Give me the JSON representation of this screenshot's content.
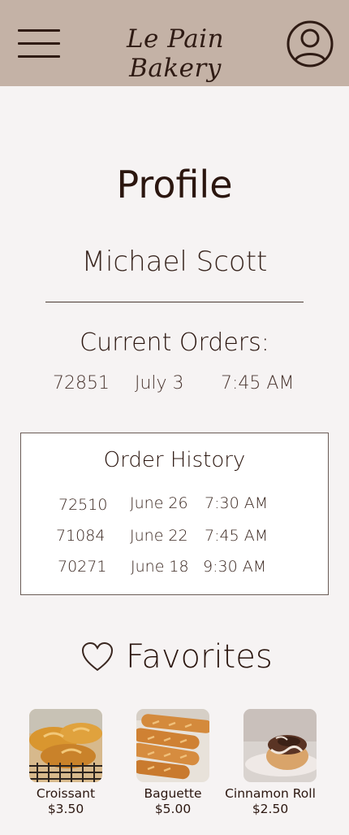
{
  "header": {
    "brand": "Le Pain Bakery",
    "menu_icon": "hamburger-menu-icon",
    "profile_icon": "user-circle-icon",
    "background_color": "#c4b2a6"
  },
  "profile": {
    "title": "Profile",
    "name": "Michael Scott"
  },
  "current_orders": {
    "title": "Current Orders:",
    "order": {
      "id": "72851",
      "date": "July 3",
      "time": "7:45 AM"
    }
  },
  "order_history": {
    "title": "Order History",
    "orders": [
      {
        "id": "72510",
        "date": "June 26",
        "time": "7:30 AM"
      },
      {
        "id": "71084",
        "date": "June 22",
        "time": "7:45 AM"
      },
      {
        "id": "70271",
        "date": "June 18",
        "time": "9:30 AM"
      }
    ]
  },
  "favorites": {
    "title": "Favorites",
    "icon": "heart-icon",
    "items": [
      {
        "name": "Croissant",
        "price": "$3.50"
      },
      {
        "name": "Baguette",
        "price": "$5.00"
      },
      {
        "name": "Cinnamon Roll",
        "price": "$2.50"
      }
    ]
  }
}
